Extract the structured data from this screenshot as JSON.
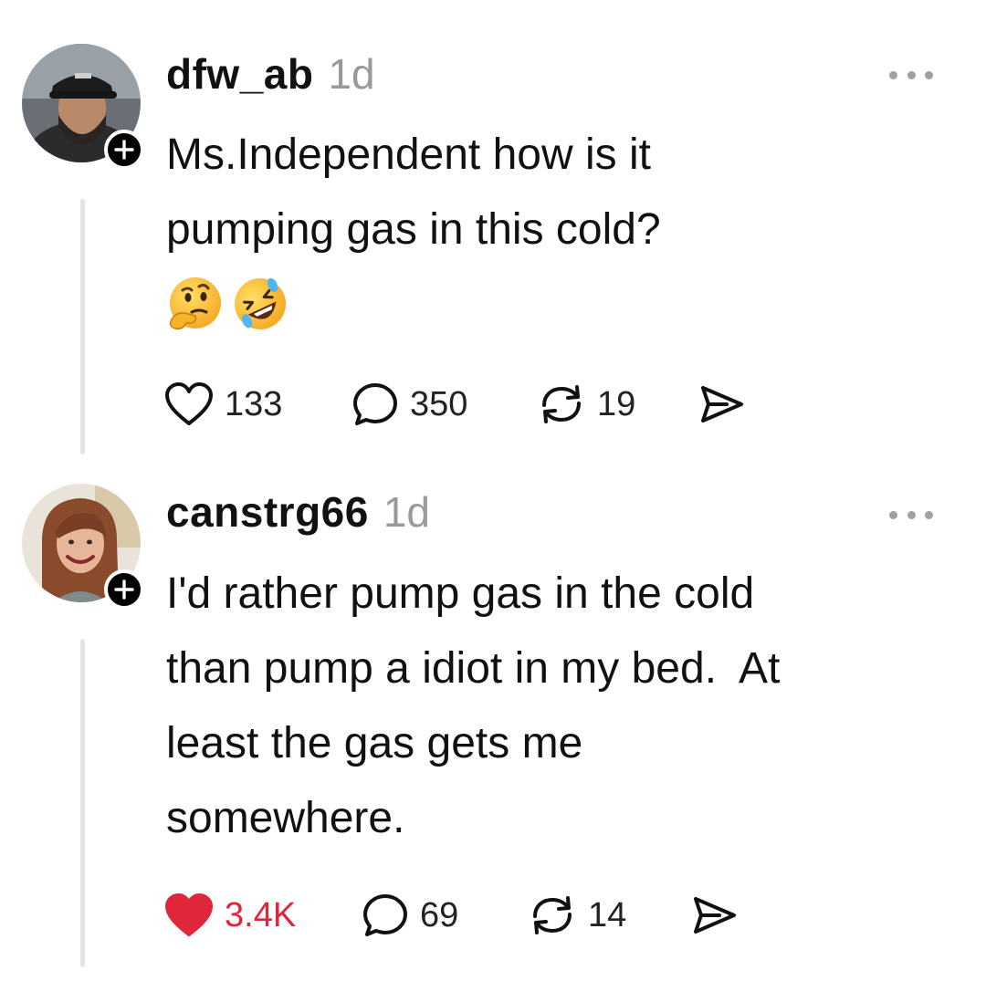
{
  "posts": [
    {
      "username": "dfw_ab",
      "time": "1d",
      "lines": [
        "Ms.Independent how is it",
        "pumping gas in this cold?"
      ],
      "emojis": [
        "thinking-face",
        "rolling-on-floor-laughing"
      ],
      "likes": "133",
      "liked": false,
      "replies": "350",
      "reposts": "19"
    },
    {
      "username": "canstrg66",
      "time": "1d",
      "lines": [
        "I'd rather pump gas in the cold",
        "than pump a idiot in my bed.  At",
        "least the gas gets me",
        "somewhere."
      ],
      "likes": "3.4K",
      "liked": true,
      "replies": "69",
      "reposts": "14"
    }
  ],
  "icons": {
    "like": "heart-icon",
    "reply": "speech-bubble-icon",
    "repost": "repost-arrows-icon",
    "share": "send-icon",
    "more": "more-dots-icon",
    "follow": "plus-icon"
  },
  "colors": {
    "liked": "#e0263a",
    "text": "#111111",
    "muted": "#999999",
    "thread_line": "#e4e4e4"
  }
}
